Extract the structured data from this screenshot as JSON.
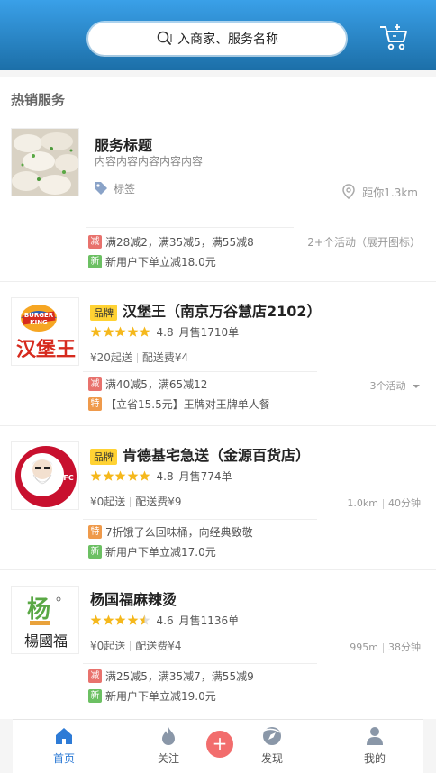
{
  "search": {
    "placeholder": "入商家、服务名称"
  },
  "section_title": "热销服务",
  "service_card": {
    "title": "服务标题",
    "subtitle": "内容内容内容内容内容",
    "tag": "标签",
    "distance": "距你1.3km",
    "promos": [
      {
        "badge": "减",
        "text": "满28减2，满35减5，满55减8"
      },
      {
        "badge": "新",
        "text": "新用户下单立减18.0元"
      }
    ],
    "more": "2+个活动（展开图标）"
  },
  "stores": [
    {
      "logo": "burger-king-logo",
      "brand_badge": "品牌",
      "name": "汉堡王（南京万谷慧店2102）",
      "rating": 4.8,
      "rating_text": "4.8",
      "sales": "月售1710单",
      "min_order": "¥20起送",
      "delivery_fee": "配送费¥4",
      "distance": "",
      "time": "",
      "promos": [
        {
          "badge": "减",
          "text": "满40减5，满65减12"
        },
        {
          "badge": "特",
          "text": "【立省15.5元】王牌对王牌单人餐"
        }
      ],
      "more": "3个活动"
    },
    {
      "logo": "kfc-logo",
      "brand_badge": "品牌",
      "name": "肯德基宅急送（金源百货店）",
      "rating": 4.8,
      "rating_text": "4.8",
      "sales": "月售774单",
      "min_order": "¥0起送",
      "delivery_fee": "配送费¥9",
      "distance": "1.0km",
      "time": "40分钟",
      "promos": [
        {
          "badge": "特",
          "text": "7折饿了么回味桶，向经典致敬"
        },
        {
          "badge": "新",
          "text": "新用户下单立减17.0元"
        }
      ],
      "more": ""
    },
    {
      "logo": "yangguofu-logo",
      "brand_badge": "",
      "name": "杨国福麻辣烫",
      "rating": 4.6,
      "rating_text": "4.6",
      "sales": "月售1136单",
      "min_order": "¥0起送",
      "delivery_fee": "配送费¥4",
      "distance": "995m",
      "time": "38分钟",
      "promos": [
        {
          "badge": "减",
          "text": "满25减5，满35减7，满55减9"
        },
        {
          "badge": "新",
          "text": "新用户下单立减19.0元"
        }
      ],
      "more": ""
    }
  ],
  "tabs": [
    {
      "label": "首页",
      "icon": "home-icon",
      "active": true
    },
    {
      "label": "关注",
      "icon": "flame-icon",
      "active": false
    },
    {
      "label": "发现",
      "icon": "compass-icon",
      "active": false
    },
    {
      "label": "我的",
      "icon": "user-icon",
      "active": false
    }
  ],
  "colors": {
    "header_top": "#3aa0e8",
    "header_bottom": "#1c6fa8",
    "active_tab": "#2e7bd6",
    "star": "#f5b81c",
    "brand_badge": "#ffd233",
    "plus_button": "#f26d6d"
  }
}
